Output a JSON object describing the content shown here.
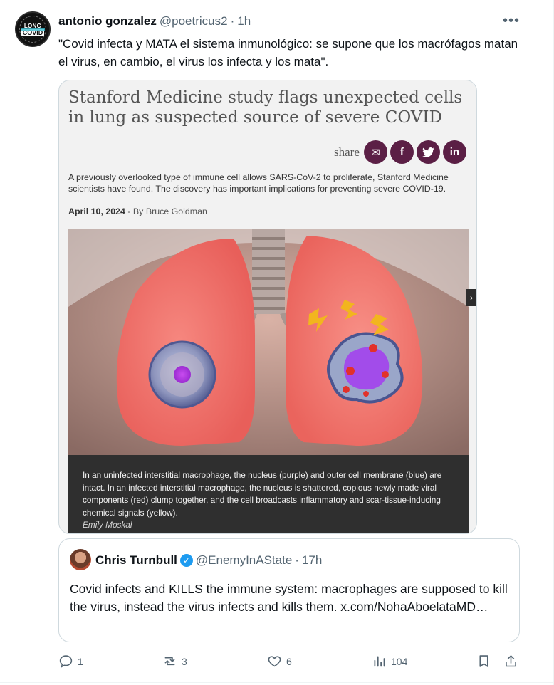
{
  "tweet": {
    "author_name": "antonio gonzalez",
    "author_handle": "@poetricus2",
    "separator": "·",
    "time": "1h",
    "more_label": "•••",
    "avatar_text_top": "LONG",
    "avatar_text_bottom": "COVID",
    "text": "\"Covid infecta y MATA el sistema inmunológico: se supone que los macrófagos matan el virus, en cambio, el virus los infecta y los mata\"."
  },
  "article": {
    "title": "Stanford Medicine study flags unexpected cells in lung as suspected source of severe COVID",
    "share_label": "share",
    "share_buttons": [
      {
        "icon": "envelope-icon",
        "glyph": "✉"
      },
      {
        "icon": "facebook-icon",
        "glyph": "f"
      },
      {
        "icon": "twitter-icon",
        "glyph": "🐦"
      },
      {
        "icon": "linkedin-icon",
        "glyph": "in"
      }
    ],
    "summary": "A previously overlooked type of immune cell allows SARS-CoV-2 to proliferate, Stanford Medicine scientists have found. The discovery has important implications for preventing severe COVID-19.",
    "date": "April 10, 2024",
    "byline": " - By Bruce Goldman",
    "caption": "In an uninfected interstitial macrophage, the nucleus (purple) and outer cell membrane (blue) are intact. In an infected interstitial macrophage, the nucleus is shattered, copious newly made viral components (red) clump together, and the cell broadcasts inflammatory and scar-tissue-inducing chemical signals (yellow).",
    "credit": "Emily Moskal",
    "colors": {
      "share_button": "#5b1f45",
      "caption_bg": "#2f2f2f"
    }
  },
  "quote": {
    "author_name": "Chris Turnbull",
    "author_handle": "@EnemyInAState",
    "separator": "·",
    "time": "17h",
    "text": "Covid infects and KILLS the immune system: macrophages are supposed to kill the virus, instead the virus infects and kills them. x.com/NohaAboelataMD…"
  },
  "actions": {
    "replies": "1",
    "reposts": "3",
    "likes": "6",
    "views": "104"
  },
  "colors": {
    "accent": "#1d9bf0",
    "secondary_text": "#536471",
    "border": "#cfd9de"
  }
}
